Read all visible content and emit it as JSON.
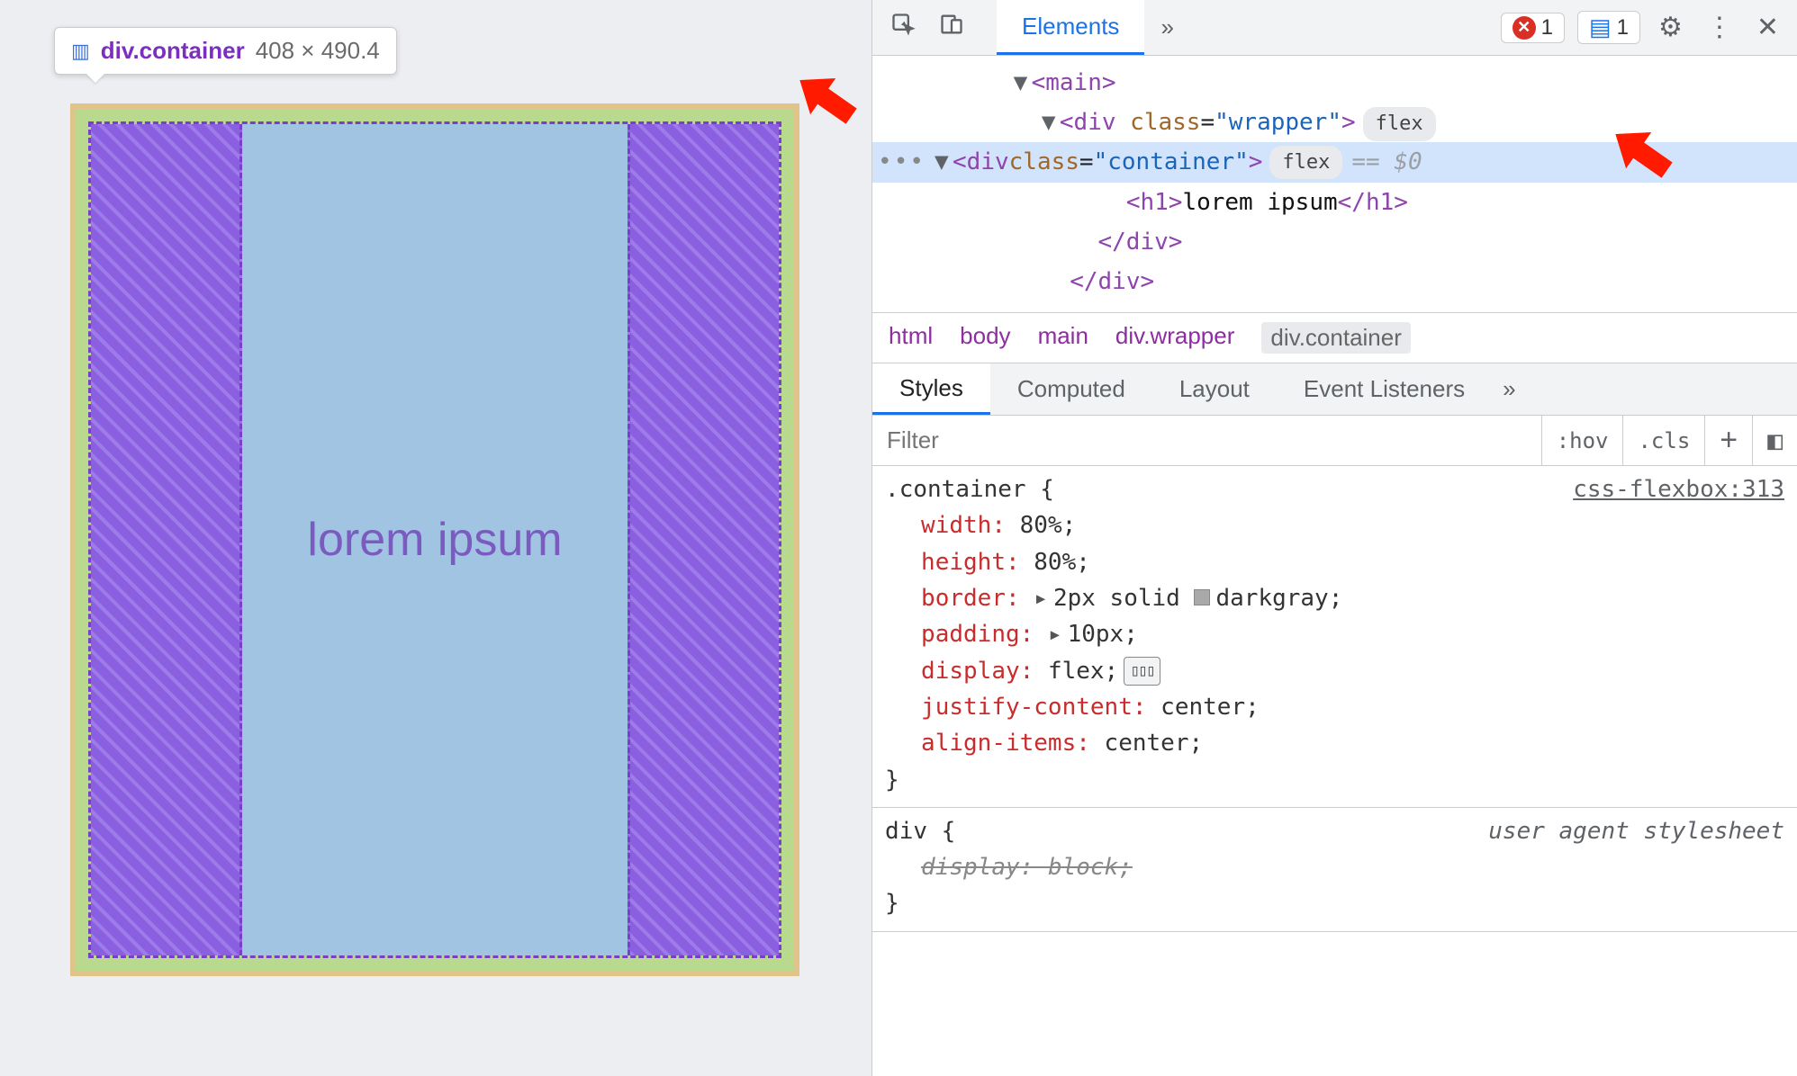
{
  "tooltip": {
    "tag": "div",
    "class": ".container",
    "dimensions": "408 × 490.4"
  },
  "preview": {
    "content_text": "lorem ipsum"
  },
  "toolbar": {
    "tabs": {
      "elements": "Elements"
    },
    "error_count": "1",
    "message_count": "1"
  },
  "dom": {
    "main_open": "<main>",
    "wrapper_open_tag": "div",
    "wrapper_class_attr": "class",
    "wrapper_class_val": "\"wrapper\"",
    "container_open_tag": "div",
    "container_class_attr": "class",
    "container_class_val": "\"container\"",
    "h1_tag": "h1",
    "h1_text": "lorem ipsum",
    "div_close": "</div>",
    "badge_flex": "flex",
    "eq0": "== $0"
  },
  "breadcrumb": {
    "items": [
      "html",
      "body",
      "main",
      "div.wrapper",
      "div.container"
    ]
  },
  "styles_tabs": {
    "styles": "Styles",
    "computed": "Computed",
    "layout": "Layout",
    "event_listeners": "Event Listeners"
  },
  "filter": {
    "placeholder": "Filter",
    "hov": ":hov",
    "cls": ".cls"
  },
  "css": {
    "rule1": {
      "source": "css-flexbox:313",
      "selector": ".container {",
      "props": {
        "width": "width",
        "width_v": "80%;",
        "height": "height",
        "height_v": "80%;",
        "border": "border",
        "border_v1": "2px solid",
        "border_v2": "darkgray;",
        "padding": "padding",
        "padding_v": "10px;",
        "display": "display",
        "display_v": "flex;",
        "jc": "justify-content",
        "jc_v": "center;",
        "ai": "align-items",
        "ai_v": "center;"
      },
      "close": "}"
    },
    "rule2": {
      "source": "user agent stylesheet",
      "selector": "div {",
      "props": {
        "display": "display",
        "display_v": "block;"
      },
      "close": "}"
    }
  }
}
